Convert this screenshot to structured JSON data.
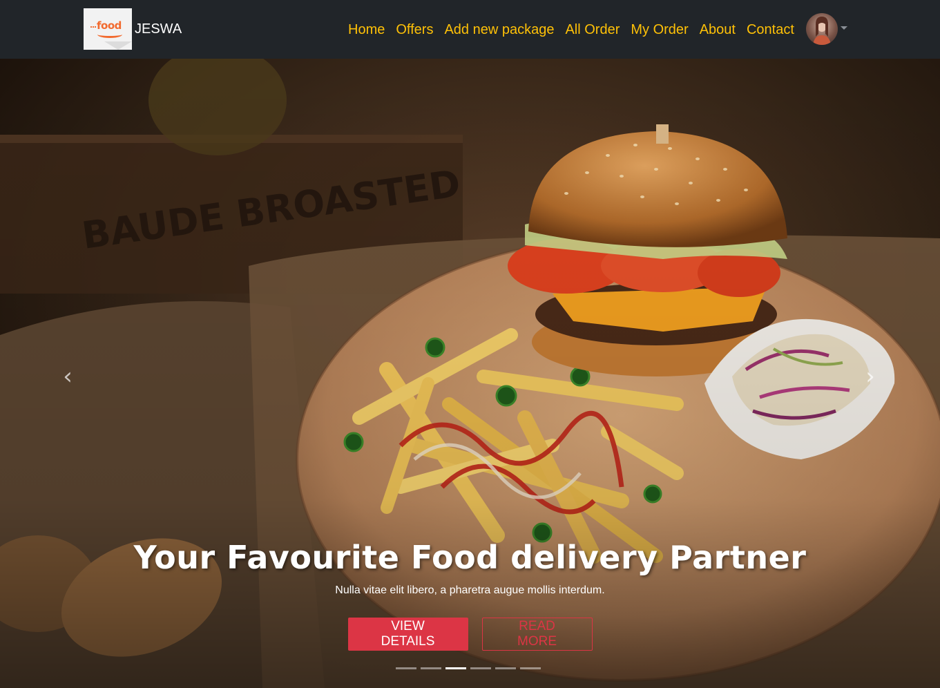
{
  "navbar": {
    "brand_name": "JESWA",
    "logo_text": "food",
    "links": [
      {
        "label": "Home"
      },
      {
        "label": "Offers"
      },
      {
        "label": "Add new package"
      },
      {
        "label": "All Order"
      },
      {
        "label": "My Order"
      },
      {
        "label": "About"
      },
      {
        "label": "Contact"
      }
    ],
    "link_color": "#ffc107",
    "background": "#212529"
  },
  "carousel": {
    "caption_title": "Your Favourite Food delivery Partner",
    "caption_subtitle": "Nulla vitae elit libero, a pharetra augue mollis interdum.",
    "primary_button": "VIEW DETAILS",
    "secondary_button": "READ MORE",
    "accent_color": "#dc3545",
    "prev_icon": "chevron-left-icon",
    "next_icon": "chevron-right-icon",
    "slide_count": 6,
    "active_slide": 3
  }
}
